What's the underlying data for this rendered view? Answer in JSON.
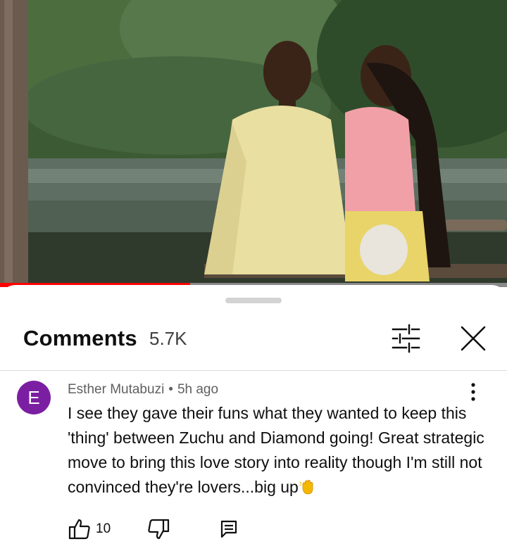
{
  "video": {
    "progress_fraction": 0.375,
    "progress_color": "#ff0000"
  },
  "comments_panel": {
    "title": "Comments",
    "count": "5.7K",
    "icons": {
      "filter": "sliders-filter-icon",
      "close": "close-icon"
    }
  },
  "comment": {
    "avatar_letter": "E",
    "avatar_color": "#7b1fa2",
    "author": "Esther Mutabuzi",
    "separator": "•",
    "time": "5h ago",
    "text": "I see they gave their funs what they wanted to keep this 'thing' between Zuchu and Diamond going! Great strategic move to bring this love story into reality though I'm still not convinced they're lovers...big up",
    "emoji": "waving-hand-icon",
    "likes": "10",
    "icons": {
      "more": "more-vert-icon",
      "like": "thumbs-up-icon",
      "dislike": "thumbs-down-icon",
      "reply": "reply-comment-icon"
    }
  }
}
